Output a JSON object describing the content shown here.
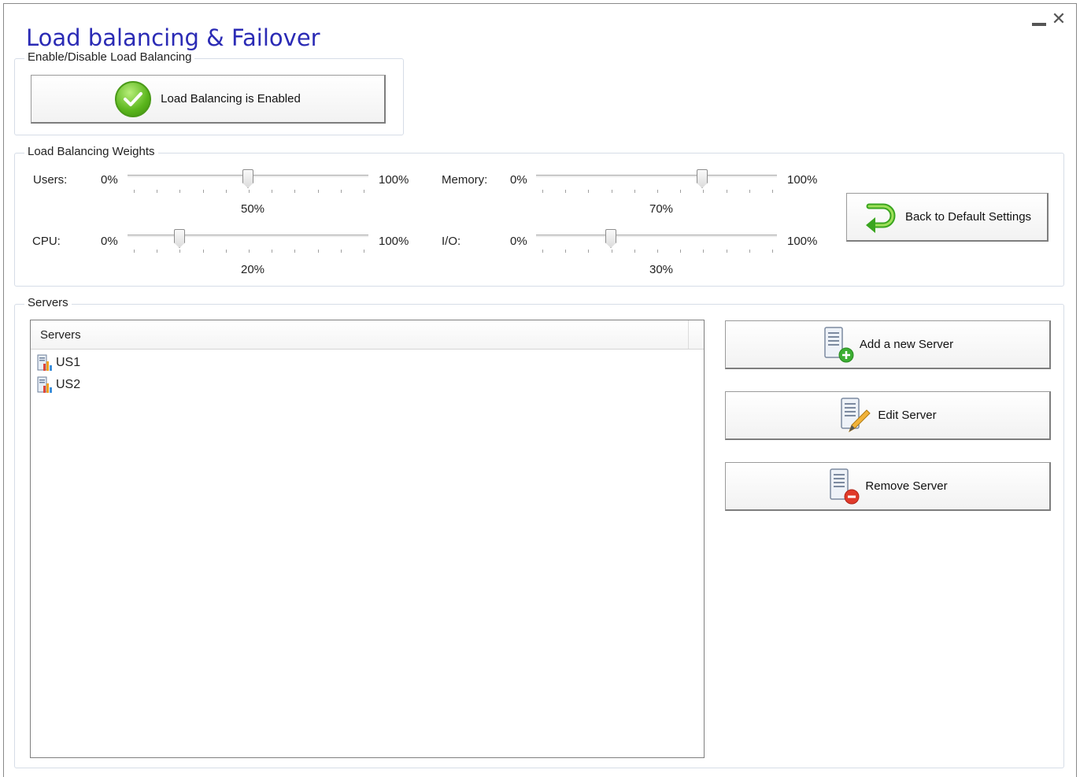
{
  "window": {
    "title": "Load balancing & Failover"
  },
  "enable_group": {
    "legend": "Enable/Disable Load Balancing",
    "toggle_label": "Load Balancing is Enabled"
  },
  "weights_group": {
    "legend": "Load Balancing Weights",
    "min_label": "0%",
    "max_label": "100%",
    "sliders": [
      {
        "label": "Users:",
        "value_text": "50%",
        "value": 0.5
      },
      {
        "label": "Memory:",
        "value_text": "70%",
        "value": 0.7
      },
      {
        "label": "CPU:",
        "value_text": "20%",
        "value": 0.2
      },
      {
        "label": "I/O:",
        "value_text": "30%",
        "value": 0.3
      }
    ],
    "default_button": "Back to Default Settings"
  },
  "servers_group": {
    "legend": "Servers",
    "column_header": "Servers",
    "items": [
      "US1",
      "US2"
    ],
    "add_button": "Add a new Server",
    "edit_button": "Edit Server",
    "remove_button": "Remove Server"
  },
  "colors": {
    "title": "#2b2bb5",
    "check": "#5ab51c",
    "remove": "#e03a2a",
    "add": "#3cae32"
  }
}
